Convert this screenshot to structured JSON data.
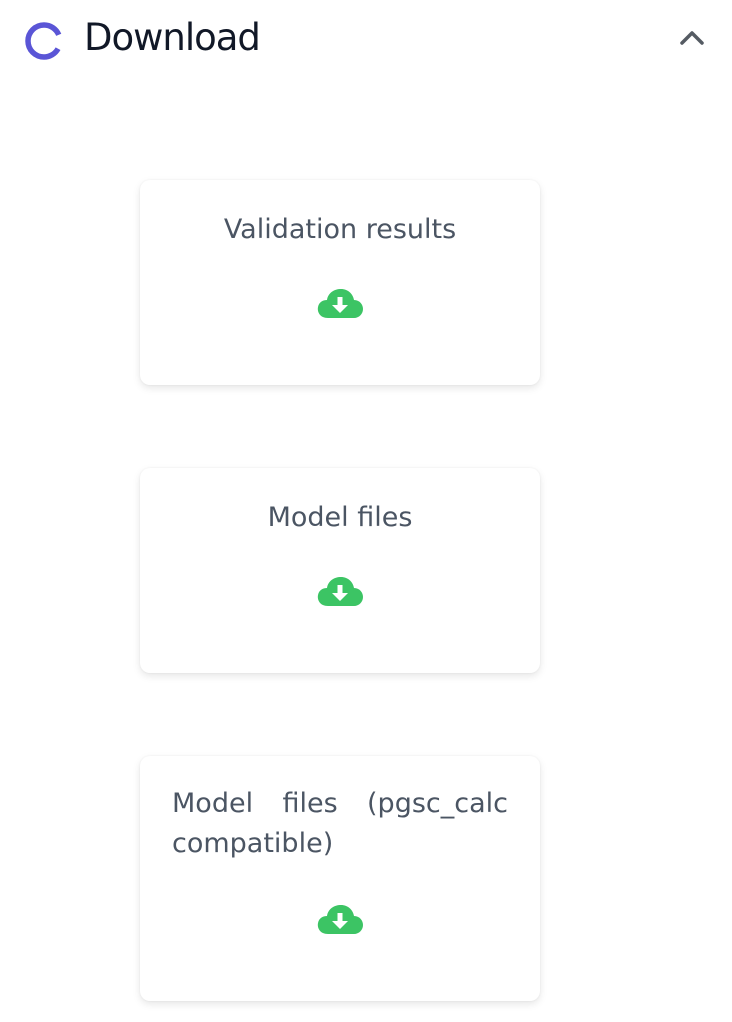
{
  "header": {
    "icon": "spinner-ring-icon",
    "title": "Download",
    "collapse_icon": "chevron-up-icon"
  },
  "colors": {
    "accent": "#5a55d6",
    "download": "#3cc464",
    "text": "#4b5563",
    "title": "#111827"
  },
  "cards": [
    {
      "label": "Validation results",
      "icon": "cloud-download-icon"
    },
    {
      "label": "Model files",
      "icon": "cloud-download-icon"
    },
    {
      "label": "Model files (pgsc_calc compatible)",
      "icon": "cloud-download-icon"
    }
  ]
}
